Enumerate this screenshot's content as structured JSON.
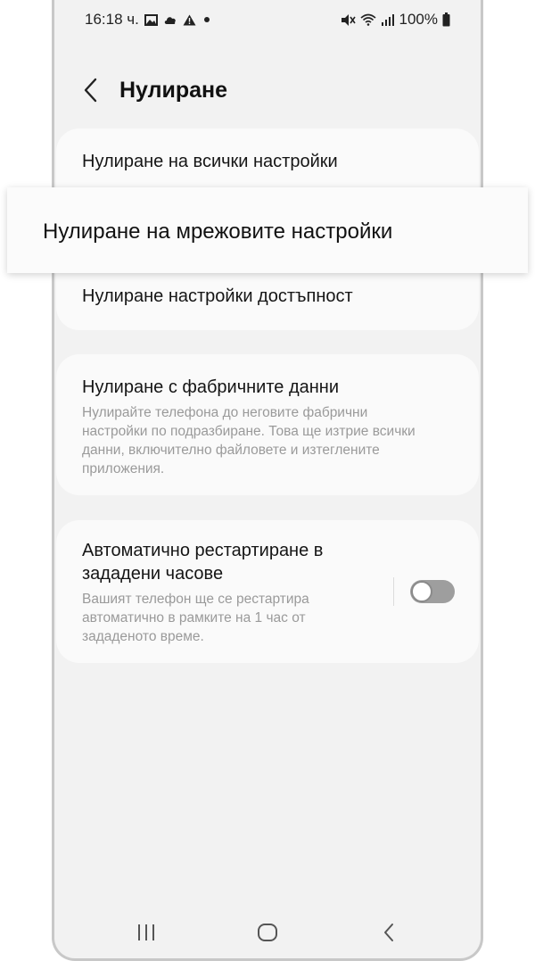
{
  "status_bar": {
    "time": "16:18 ч.",
    "battery": "100%",
    "icons_left": [
      "image-icon",
      "cloud-icon",
      "warning-icon",
      "dot-icon"
    ],
    "icons_right": [
      "mute-icon",
      "wifi-icon",
      "signal-icon",
      "battery-icon"
    ]
  },
  "header": {
    "title": "Нулиране"
  },
  "reset_options": {
    "all_settings": "Нулиране на всички настройки",
    "network_settings": "Нулиране на мрежовите настройки",
    "accessibility_settings": "Нулиране настройки достъпност"
  },
  "factory_reset": {
    "title": "Нулиране с фабричните данни",
    "description": "Нулирайте телефона до неговите фабрични настройки по подразбиране. Това ще изтрие всички данни, включително файловете и изтеглените приложения."
  },
  "auto_restart": {
    "title_line1": "Автоматично рестартиране в",
    "title_line2": "зададени часове",
    "description": "Вашият телефон ще се рестартира автоматично в рамките на 1 час от зададеното време.",
    "enabled": false
  },
  "nav": {
    "icons": [
      "recent-apps-icon",
      "home-icon",
      "back-icon"
    ]
  },
  "colors": {
    "screen_bg": "#f2f2f2",
    "card_bg": "#fafafa",
    "toggle_off": "#9e9e9e"
  }
}
